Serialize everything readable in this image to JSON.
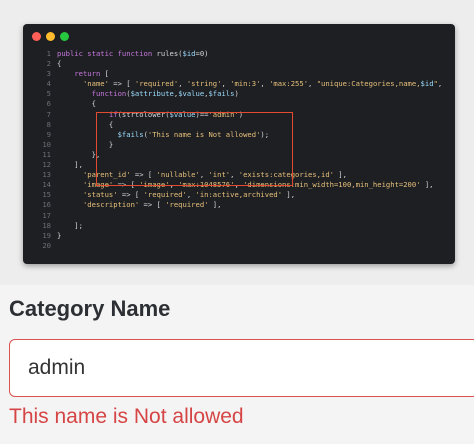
{
  "window": {
    "dots": [
      {
        "name": "close",
        "color": "#ff5f56"
      },
      {
        "name": "minimize",
        "color": "#ffbd2e"
      },
      {
        "name": "maximize",
        "color": "#27c93f"
      }
    ]
  },
  "code": {
    "lines": [
      {
        "num": "1",
        "text": "public static function rules($id=0)"
      },
      {
        "num": "2",
        "text": "{"
      },
      {
        "num": "3",
        "text": "    return ["
      },
      {
        "num": "4",
        "text": "      'name' => [ 'required', 'string', 'min:3', 'max:255', \"unique:Categories,name,$id\","
      },
      {
        "num": "5",
        "text": "        function($attribute,$value,$fails)"
      },
      {
        "num": "6",
        "text": "        {"
      },
      {
        "num": "7",
        "text": "            if(strtolower($value)=='admin')"
      },
      {
        "num": "8",
        "text": "            {"
      },
      {
        "num": "9",
        "text": "              $fails('This name is Not allowed');"
      },
      {
        "num": "10",
        "text": "            }"
      },
      {
        "num": "11",
        "text": "        },"
      },
      {
        "num": "12",
        "text": "    ],"
      },
      {
        "num": "13",
        "text": "      'parent_id' => [ 'nullable', 'int', 'exists:categories,id' ],"
      },
      {
        "num": "14",
        "text": "      'image' => [ 'image', 'max:1048576', 'dimensions:min_width=100,min_height=200' ],"
      },
      {
        "num": "15",
        "text": "      'status' => [ 'required', 'in:active,archived' ],"
      },
      {
        "num": "16",
        "text": "      'description' => [ 'required' ],"
      },
      {
        "num": "17",
        "text": ""
      },
      {
        "num": "18",
        "text": "    ];"
      },
      {
        "num": "19",
        "text": "}"
      },
      {
        "num": "20",
        "text": ""
      }
    ],
    "highlight_color": "#e24b2f"
  },
  "form": {
    "label": "Category Name",
    "input_value": "admin",
    "error_message": "This name is Not allowed",
    "error_color": "#d64545"
  }
}
